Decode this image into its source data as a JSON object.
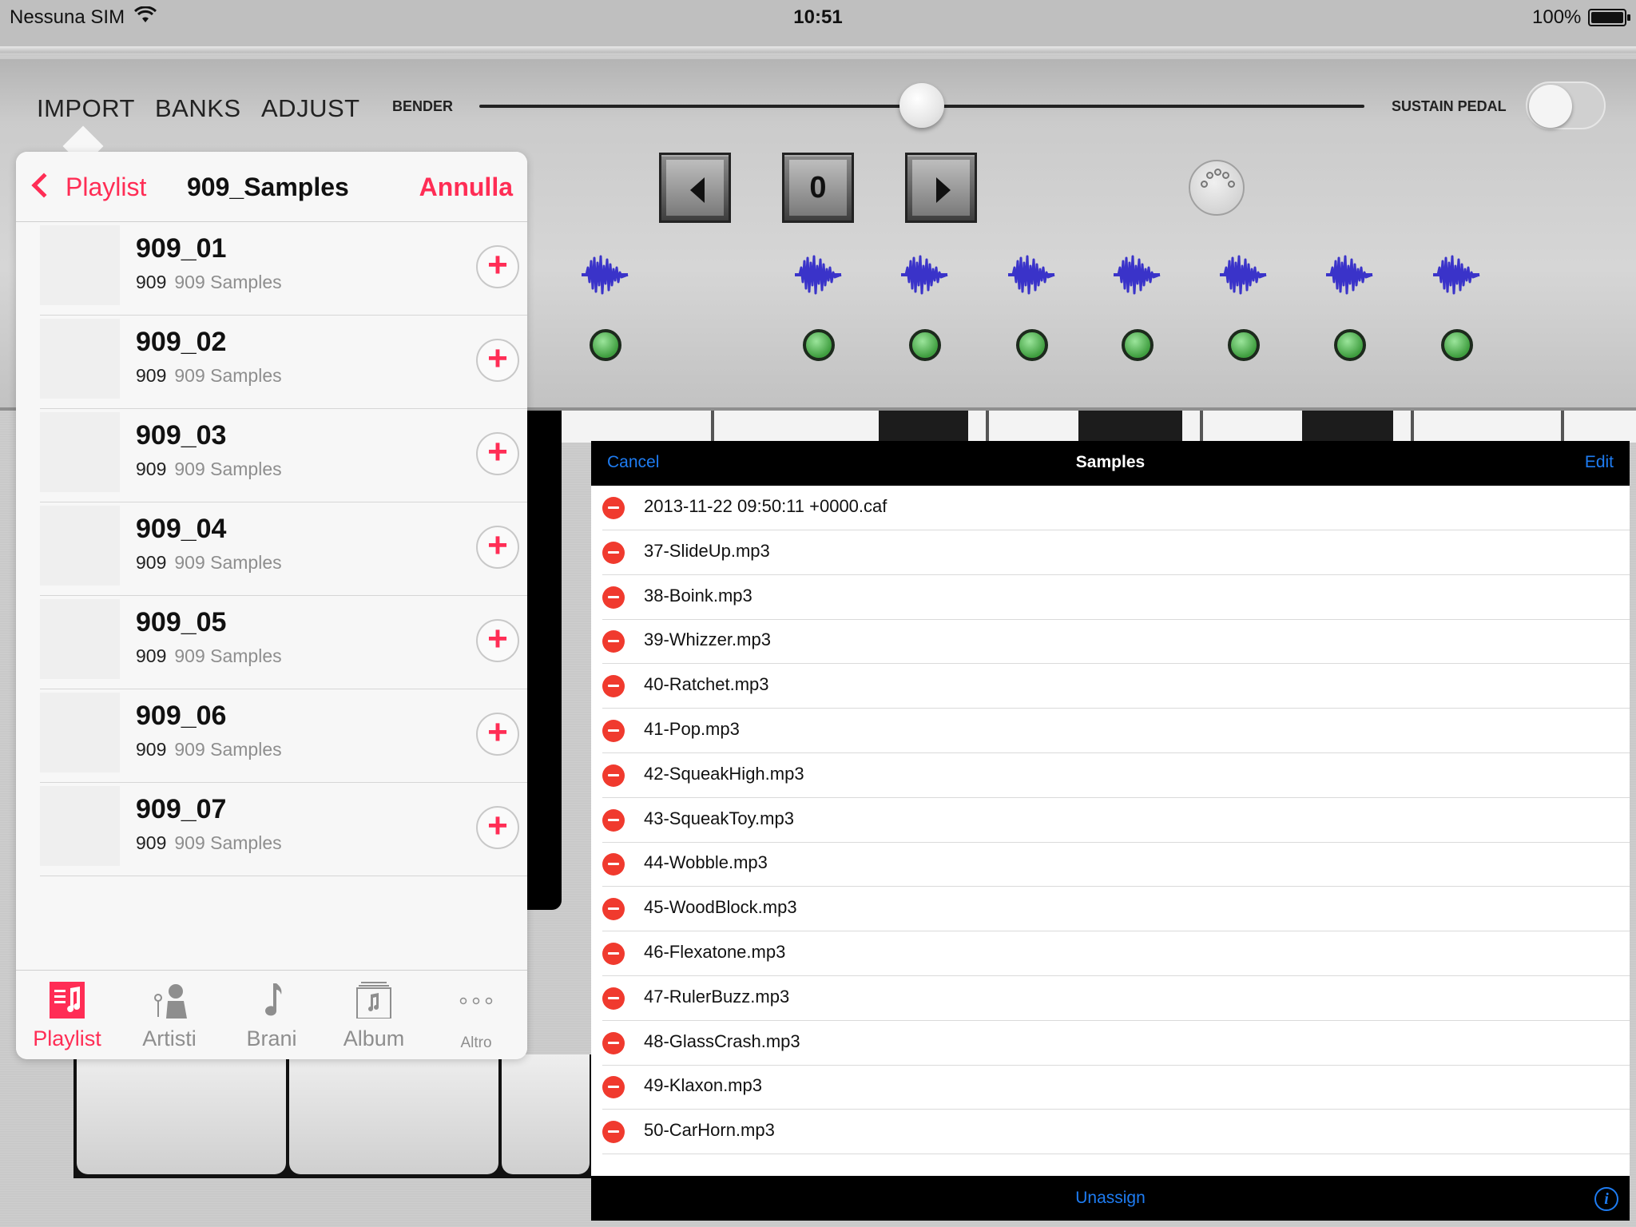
{
  "status_bar": {
    "carrier": "Nessuna SIM",
    "time": "10:51",
    "battery": "100%"
  },
  "toolbar": {
    "menu": [
      "IMPORT",
      "BANKS",
      "ADJUST"
    ],
    "bender_label": "BENDER",
    "sustain_label": "SUSTAIN PEDAL",
    "bank_value": "0"
  },
  "music_picker": {
    "back_label": "Playlist",
    "title": "909_Samples",
    "cancel_label": "Annulla",
    "songs": [
      {
        "title": "909_01",
        "artist": "909",
        "album": "909 Samples"
      },
      {
        "title": "909_02",
        "artist": "909",
        "album": "909 Samples"
      },
      {
        "title": "909_03",
        "artist": "909",
        "album": "909 Samples"
      },
      {
        "title": "909_04",
        "artist": "909",
        "album": "909 Samples"
      },
      {
        "title": "909_05",
        "artist": "909",
        "album": "909 Samples"
      },
      {
        "title": "909_06",
        "artist": "909",
        "album": "909 Samples"
      },
      {
        "title": "909_07",
        "artist": "909",
        "album": "909 Samples"
      }
    ],
    "tabs": [
      {
        "label": "Playlist",
        "icon": "playlist-icon",
        "active": true
      },
      {
        "label": "Artisti",
        "icon": "artist-icon",
        "active": false
      },
      {
        "label": "Brani",
        "icon": "music-note-icon",
        "active": false
      },
      {
        "label": "Album",
        "icon": "album-icon",
        "active": false
      },
      {
        "label": "Altro",
        "icon": "more-icon",
        "active": false
      }
    ]
  },
  "samples_panel": {
    "cancel_label": "Cancel",
    "title": "Samples",
    "edit_label": "Edit",
    "items": [
      "2013-11-22 09:50:11 +0000.caf",
      "37-SlideUp.mp3",
      "38-Boink.mp3",
      "39-Whizzer.mp3",
      "40-Ratchet.mp3",
      "41-Pop.mp3",
      "42-SqueakHigh.mp3",
      "43-SqueakToy.mp3",
      "44-Wobble.mp3",
      "45-WoodBlock.mp3",
      "46-Flexatone.mp3",
      "47-RulerBuzz.mp3",
      "48-GlassCrash.mp3",
      "49-Klaxon.mp3",
      "50-CarHorn.mp3"
    ],
    "unassign_label": "Unassign"
  },
  "colors": {
    "accent_pink": "#ff2d55",
    "ios_blue": "#1e7cf2",
    "led_green": "#3f9e3f",
    "wave_blue": "#3a33c9"
  }
}
